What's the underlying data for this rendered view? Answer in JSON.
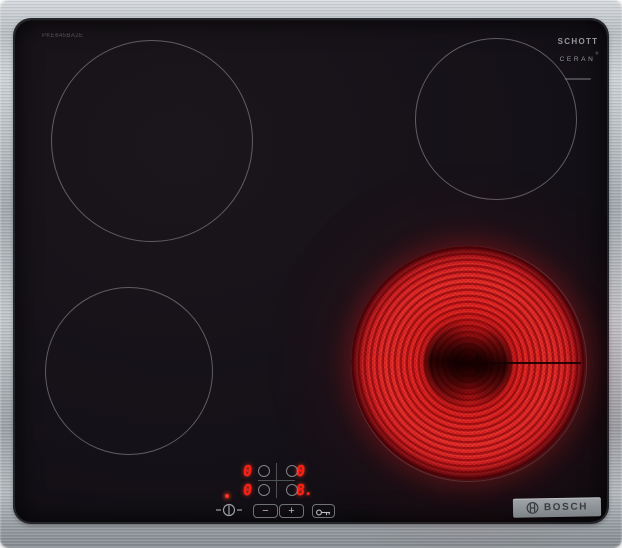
{
  "glass": {
    "model_number": "PKE645BA2E",
    "schott_logo": {
      "brand": "SCHOTT",
      "product": "CERAN",
      "registered": "®"
    }
  },
  "badge": {
    "brand": "BOSCH"
  },
  "burners": {
    "rear_left": {
      "state": "off"
    },
    "rear_right": {
      "state": "off"
    },
    "front_left": {
      "state": "off"
    },
    "front_right": {
      "state": "on",
      "glow_color": "#e2201f"
    }
  },
  "control_panel": {
    "power_led_on": true,
    "displays": {
      "rear_left": "0",
      "rear_right": "0",
      "front_left": "0",
      "front_right": "8."
    },
    "minus_label": "−",
    "plus_label": "+",
    "display_color": "#ff1d12"
  }
}
